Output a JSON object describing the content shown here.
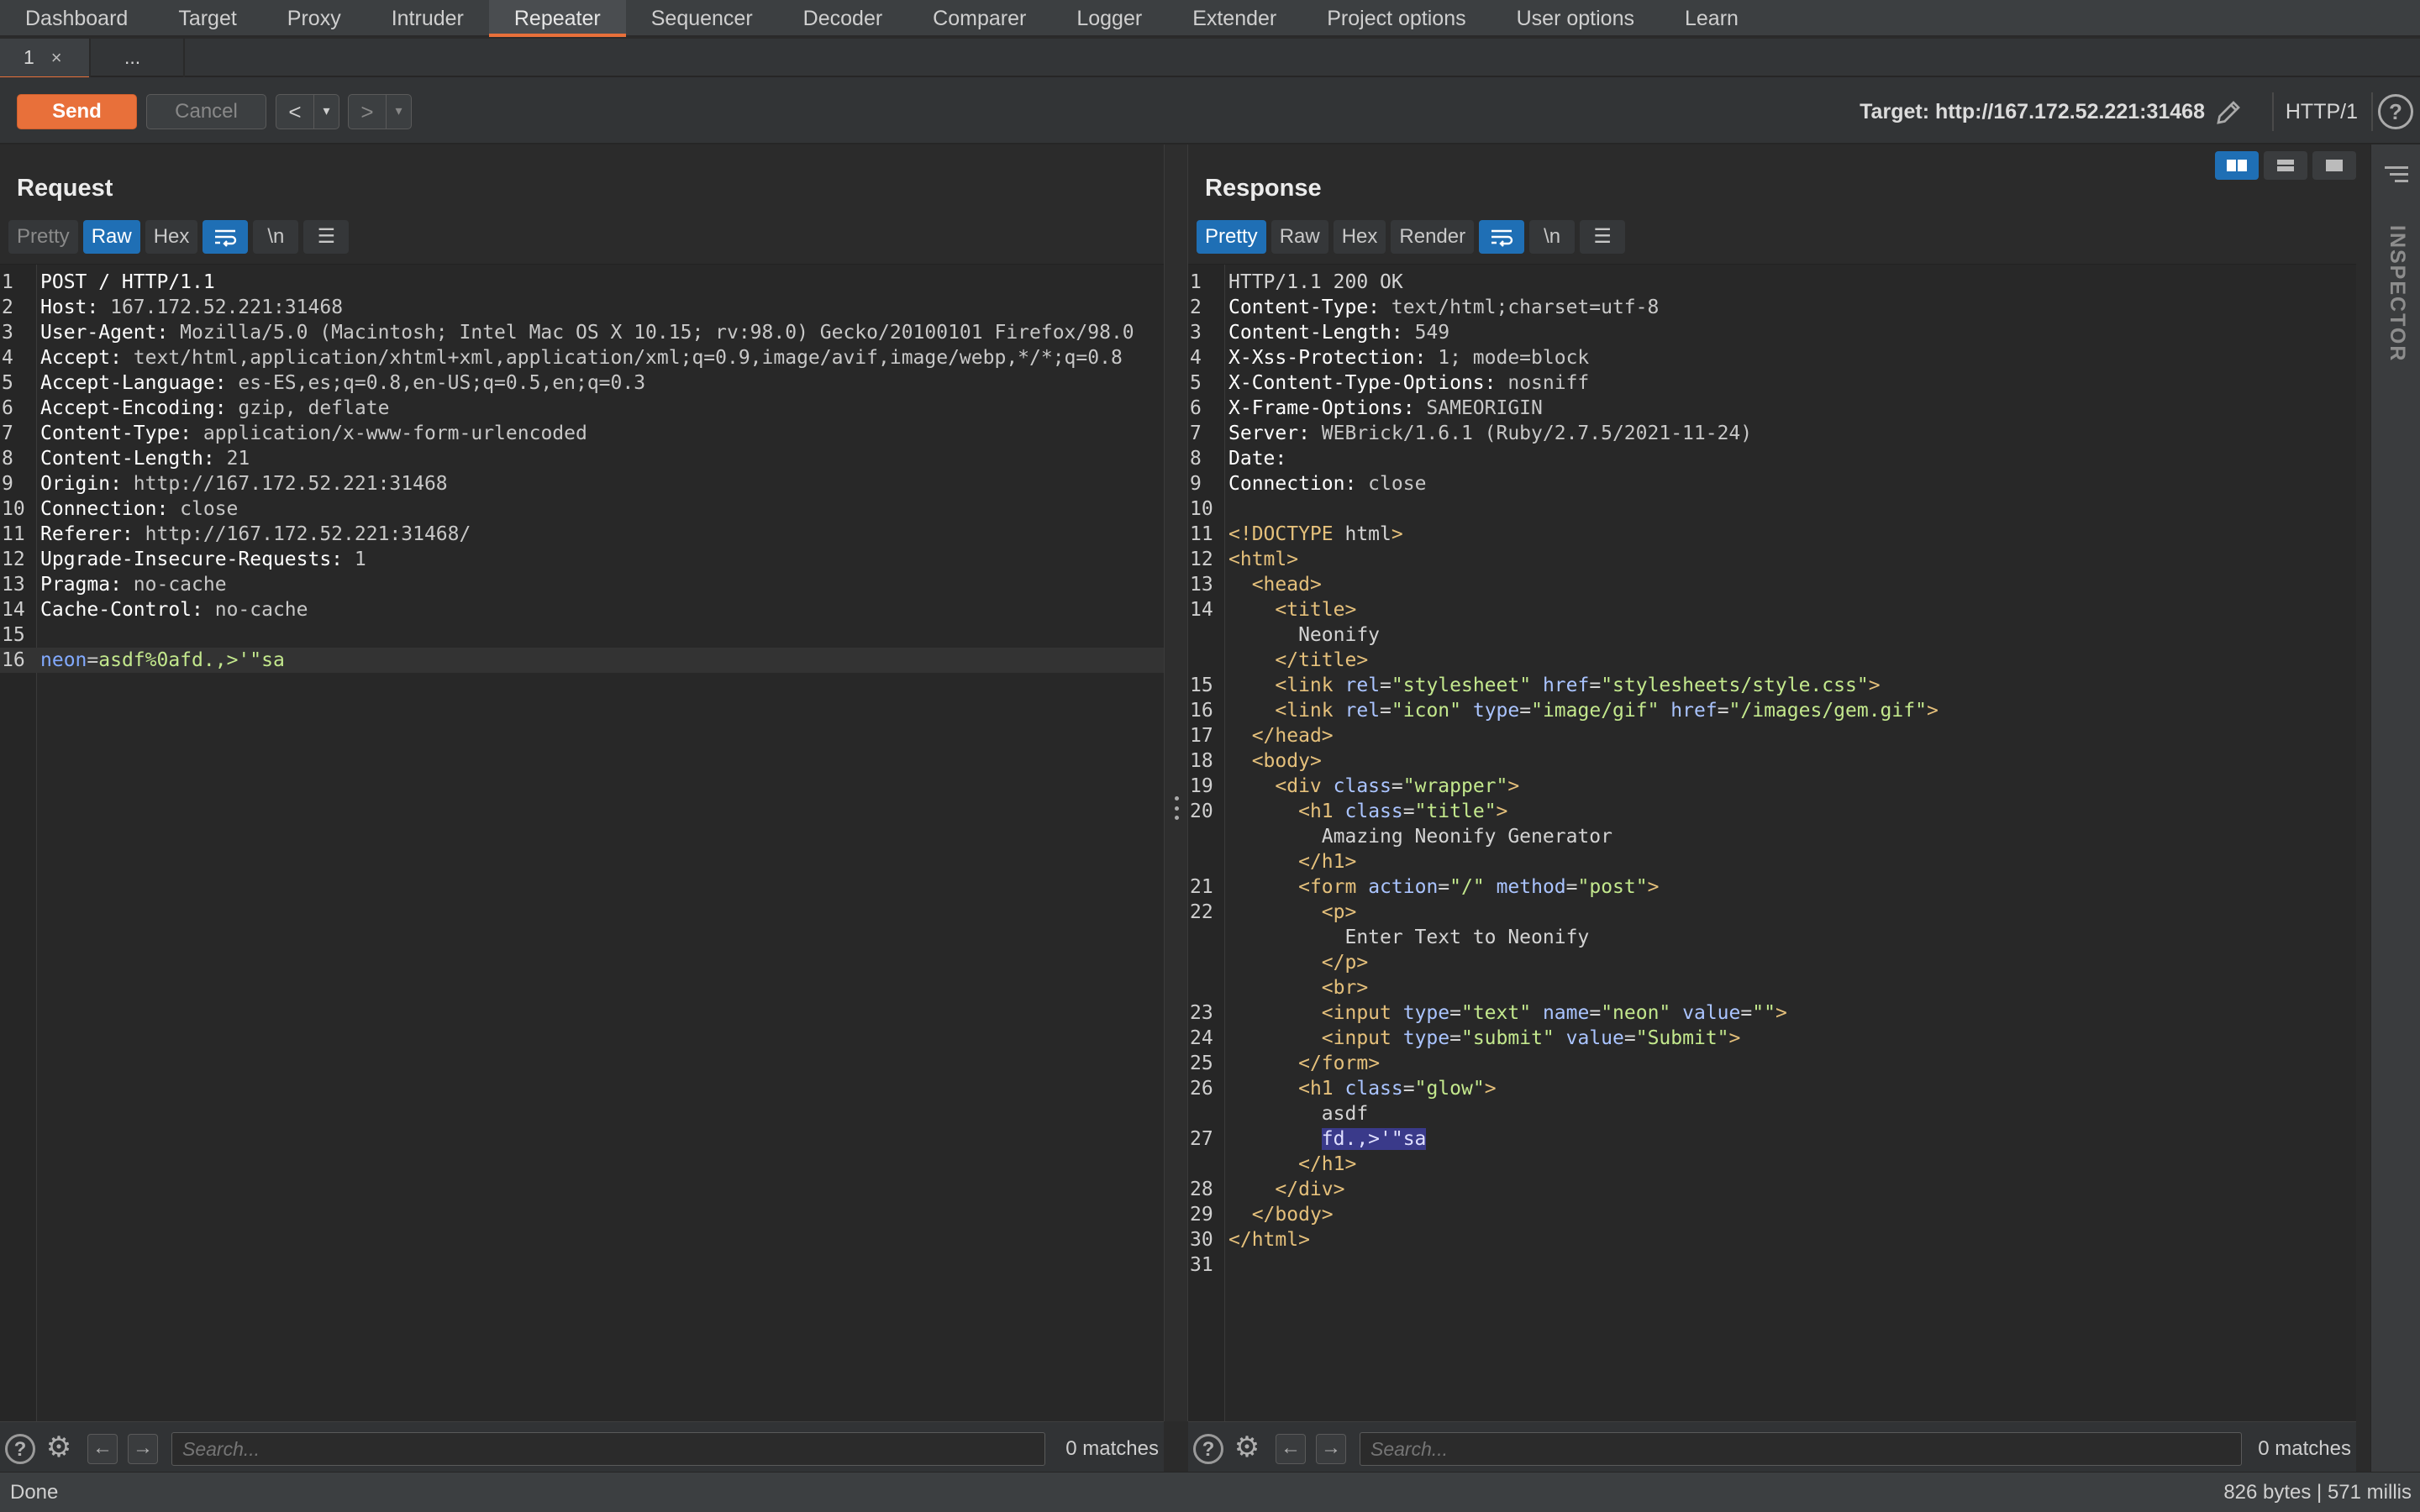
{
  "nav": {
    "tabs": [
      "Dashboard",
      "Target",
      "Proxy",
      "Intruder",
      "Repeater",
      "Sequencer",
      "Decoder",
      "Comparer",
      "Logger",
      "Extender",
      "Project options",
      "User options",
      "Learn"
    ],
    "active": "Repeater"
  },
  "subtabs": {
    "tab1": "1",
    "close": "×",
    "more": "..."
  },
  "toolbar": {
    "send": "Send",
    "cancel": "Cancel",
    "back": "<",
    "forward": ">",
    "dropdown": "▾",
    "target": "Target: http://167.172.52.221:31468",
    "http_version": "HTTP/1",
    "help": "?"
  },
  "request": {
    "title": "Request",
    "modes": [
      "Pretty",
      "Raw",
      "Hex"
    ],
    "active_mode": "Raw",
    "newline_label": "\\n",
    "lines": [
      [
        "POST / HTTP/1.1"
      ],
      [
        "Host: ",
        "167.172.52.221:31468"
      ],
      [
        "User-Agent: ",
        "Mozilla/5.0 (Macintosh; Intel Mac OS X 10.15; rv:98.0) Gecko/20100101 Firefox/98.0"
      ],
      [
        "Accept: ",
        "text/html,application/xhtml+xml,application/xml;q=0.9,image/avif,image/webp,*/*;q=0.8"
      ],
      [
        "Accept-Language: ",
        "es-ES,es;q=0.8,en-US;q=0.5,en;q=0.3"
      ],
      [
        "Accept-Encoding: ",
        "gzip, deflate"
      ],
      [
        "Content-Type: ",
        "application/x-www-form-urlencoded"
      ],
      [
        "Content-Length: ",
        "21"
      ],
      [
        "Origin: ",
        "http://167.172.52.221:31468"
      ],
      [
        "Connection: ",
        "close"
      ],
      [
        "Referer: ",
        "http://167.172.52.221:31468/"
      ],
      [
        "Upgrade-Insecure-Requests: ",
        "1"
      ],
      [
        "Pragma: ",
        "no-cache"
      ],
      [
        "Cache-Control: ",
        "no-cache"
      ],
      [
        ""
      ],
      [
        "neon",
        "=",
        "asdf%0afd.,>'\"sa"
      ]
    ],
    "current_line": 16
  },
  "response": {
    "title": "Response",
    "modes": [
      "Pretty",
      "Raw",
      "Hex",
      "Render"
    ],
    "active_mode": "Pretty",
    "newline_label": "\\n",
    "lines": [
      {
        "n": "1",
        "text": "HTTP/1.1 200 OK"
      },
      {
        "n": "2",
        "text": "Content-Type: text/html;charset=utf-8"
      },
      {
        "n": "3",
        "text": "Content-Length: 549"
      },
      {
        "n": "4",
        "text": "X-Xss-Protection: 1; mode=block"
      },
      {
        "n": "5",
        "text": "X-Content-Type-Options: nosniff"
      },
      {
        "n": "6",
        "text": "X-Frame-Options: SAMEORIGIN"
      },
      {
        "n": "7",
        "text": "Server: WEBrick/1.6.1 (Ruby/2.7.5/2021-11-24)"
      },
      {
        "n": "8",
        "text": "Date: "
      },
      {
        "n": "9",
        "text": "Connection: close"
      },
      {
        "n": "10",
        "text": ""
      },
      {
        "n": "11",
        "text": "<!DOCTYPE html>"
      },
      {
        "n": "12",
        "text": "<html>"
      },
      {
        "n": "13",
        "text": "  <head>"
      },
      {
        "n": "14",
        "text": "    <title>"
      },
      {
        "n": "",
        "text": "      Neonify"
      },
      {
        "n": "",
        "text": "    </title>"
      },
      {
        "n": "15",
        "text": "    <link rel=\"stylesheet\" href=\"stylesheets/style.css\">"
      },
      {
        "n": "16",
        "text": "    <link rel=\"icon\" type=\"image/gif\" href=\"/images/gem.gif\">"
      },
      {
        "n": "17",
        "text": "  </head>"
      },
      {
        "n": "18",
        "text": "  <body>"
      },
      {
        "n": "19",
        "text": "    <div class=\"wrapper\">"
      },
      {
        "n": "20",
        "text": "      <h1 class=\"title\">"
      },
      {
        "n": "",
        "text": "        Amazing Neonify Generator"
      },
      {
        "n": "",
        "text": "      </h1>"
      },
      {
        "n": "21",
        "text": "      <form action=\"/\" method=\"post\">"
      },
      {
        "n": "22",
        "text": "        <p>"
      },
      {
        "n": "",
        "text": "          Enter Text to Neonify"
      },
      {
        "n": "",
        "text": "        </p>"
      },
      {
        "n": "",
        "text": "        <br>"
      },
      {
        "n": "23",
        "text": "        <input type=\"text\" name=\"neon\" value=\"\">"
      },
      {
        "n": "24",
        "text": "        <input type=\"submit\" value=\"Submit\">"
      },
      {
        "n": "25",
        "text": "      </form>"
      },
      {
        "n": "26",
        "text": "      <h1 class=\"glow\">"
      },
      {
        "n": "",
        "text": "        asdf"
      },
      {
        "n": "27",
        "text": "        fd.,>'\"sa",
        "highlight": "fd.,>'\"sa"
      },
      {
        "n": "",
        "text": "      </h1>"
      },
      {
        "n": "28",
        "text": "    </div>"
      },
      {
        "n": "29",
        "text": "  </body>"
      },
      {
        "n": "30",
        "text": "</html>"
      },
      {
        "n": "31",
        "text": ""
      }
    ]
  },
  "search": {
    "placeholder": "Search...",
    "request_matches": "0 matches",
    "response_matches": "0 matches"
  },
  "inspector": {
    "label": "INSPECTOR"
  },
  "status": {
    "left": "Done",
    "right": "826 bytes | 571 millis"
  },
  "colors": {
    "accent": "#e8703a",
    "selected": "#1f6fb5",
    "background": "#2b2b2b"
  }
}
